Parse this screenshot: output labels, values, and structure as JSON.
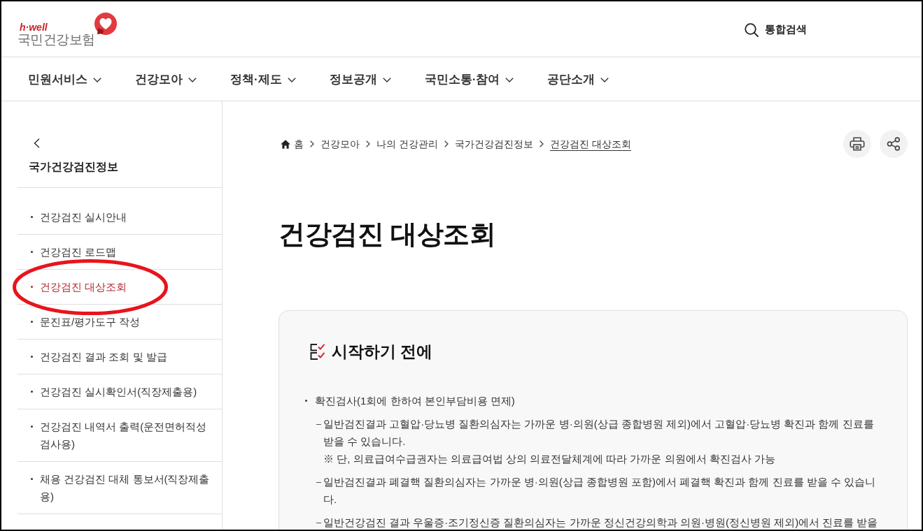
{
  "header": {
    "logo": {
      "tagline": "h·well",
      "name": "국민건강보험"
    },
    "search": {
      "label": "통합검색"
    }
  },
  "nav": [
    {
      "label": "민원서비스"
    },
    {
      "label": "건강모아"
    },
    {
      "label": "정책·제도"
    },
    {
      "label": "정보공개"
    },
    {
      "label": "국민소통·참여"
    },
    {
      "label": "공단소개"
    }
  ],
  "sidebar": {
    "title": "국가건강검진정보",
    "items": [
      {
        "label": "건강검진 실시안내",
        "selected": false,
        "circled": false
      },
      {
        "label": "건강검진 로드맵",
        "selected": false,
        "circled": false
      },
      {
        "label": "건강검진 대상조회",
        "selected": true,
        "circled": true
      },
      {
        "label": "문진표/평가도구 작성",
        "selected": false,
        "circled": false
      },
      {
        "label": "건강검진 결과 조회 및 발급",
        "selected": false,
        "circled": false
      },
      {
        "label": "건강검진 실시확인서(직장제출용)",
        "selected": false,
        "circled": false
      },
      {
        "label": "건강검진 내역서 출력(운전면허적성검사용)",
        "selected": false,
        "circled": false
      },
      {
        "label": "채용 건강검진 대체 통보서(직장제출용)",
        "selected": false,
        "circled": false
      }
    ]
  },
  "breadcrumb": [
    {
      "label": "홈",
      "kind": "home",
      "current": false
    },
    {
      "label": "건강모아",
      "kind": "link",
      "current": false
    },
    {
      "label": "나의 건강관리",
      "kind": "link",
      "current": false
    },
    {
      "label": "국가건강검진정보",
      "kind": "link",
      "current": false
    },
    {
      "label": "건강검진 대상조회",
      "kind": "link",
      "current": true
    }
  ],
  "page_title": "건강검진 대상조회",
  "notice": {
    "heading": "시작하기 전에",
    "items": [
      {
        "text": "확진검사(1회에 한하여 본인부담비용 면제)",
        "children": [
          {
            "text": "일반검진결과 고혈압·당뇨병 질환의심자는 가까운 병·의원(상급 종합병원 제외)에서 고혈압·당뇨병 확진과 함께 진료를 받을 수 있습니다.",
            "note": "※ 단, 의료급여수급권자는 의료급여법 상의 의료전달체계에 따라 가까운 의원에서 확진검사 가능"
          },
          {
            "text": "일반검진결과 폐결핵 질환의심자는 가까운 병·의원(상급 종합병원 포함)에서 폐결핵 확진과 함께 진료를 받을 수 있습니다."
          },
          {
            "text": "일반건강검진 결과 우울증·조기정신증 질환의심자는 가까운 정신건강의학과 의원·병원(정신병원 제외)에서 진료를 받을"
          }
        ]
      }
    ]
  }
}
